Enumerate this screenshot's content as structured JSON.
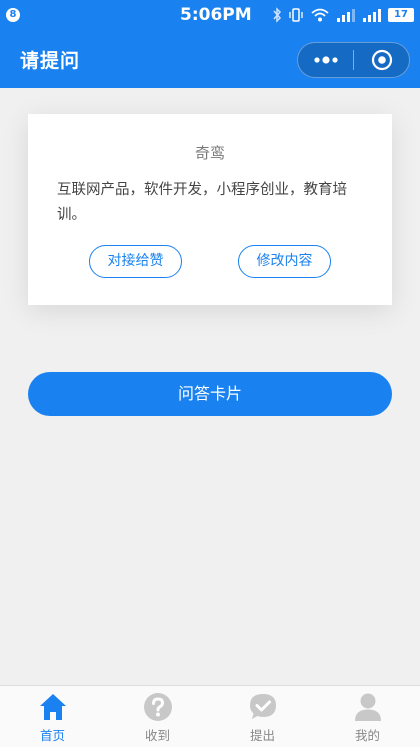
{
  "status_bar": {
    "badge": "8",
    "time": "5:06PM",
    "battery": "17"
  },
  "navbar": {
    "title": "请提问"
  },
  "card": {
    "name": "奇鸾",
    "description": "互联网产品，软件开发，小程序创业，教育培训。",
    "left_button": "对接给赞",
    "right_button": "修改内容"
  },
  "qa_button": "问答卡片",
  "tabs": [
    {
      "label": "首页",
      "icon": "home-icon",
      "active": true
    },
    {
      "label": "收到",
      "icon": "question-icon",
      "active": false
    },
    {
      "label": "提出",
      "icon": "check-icon",
      "active": false
    },
    {
      "label": "我的",
      "icon": "person-icon",
      "active": false
    }
  ],
  "colors": {
    "accent": "#1a82f0",
    "background": "#f0f0f0",
    "tab_inactive": "#c8c8c8"
  }
}
